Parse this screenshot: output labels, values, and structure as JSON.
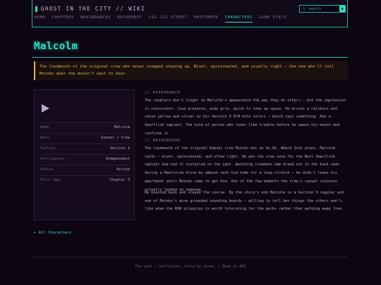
{
  "site": {
    "logo_text": "GHOST IN THE CITY // WIKI"
  },
  "search": {
    "placeholder": "// search"
  },
  "nav": {
    "items": [
      {
        "label": "HOME"
      },
      {
        "label": "CHAPTERS"
      },
      {
        "label": "BRAINDANCES"
      },
      {
        "label": "ROCKERBOY"
      },
      {
        "label": "JIG JIG STREET"
      },
      {
        "label": "PHOTOMODE"
      },
      {
        "label": "CHARACTERS"
      },
      {
        "label": "GONK STATS"
      }
    ],
    "active": "CHARACTERS"
  },
  "page": {
    "title": "Malcolm",
    "quote": "The loudmouth of the original crew who never stopped showing up. Blunt, opinionated, and usually right — the one who'll tell Motoko what she doesn't want to hear."
  },
  "infobox": {
    "icon": "play-icon",
    "rows": [
      {
        "key": "Name",
        "value": "Malcolm"
      },
      {
        "key": "Role",
        "value": "Gunner / Crew"
      },
      {
        "key": "Faction",
        "value": "Section 9"
      },
      {
        "key": "Affiliation",
        "value": "Independent"
      },
      {
        "key": "Status",
        "value": "Active"
      },
      {
        "key": "First App.",
        "value": "Chapter 3"
      }
    ]
  },
  "sections": {
    "appearance": {
      "heading": "// APPEARANCE",
      "text": "The chapters don't linger on Malcolm's appearance the way they do others', but the impression is consistent: loud presence, wide grin, quick to take up space. He drives a Caliburn and chose yellow and silver as his Section 9 ECM hole colors — which says something. Has a Smartlink implant. The kind of person who looks like trouble before he opens his mouth and confirms it."
    },
    "background": {
      "heading": "// BACKGROUND",
      "text1": "The loudmouth of the original Kabuki crew Motoko met at Hi-Oh. Where Ichi plans, Malcolm talks — blunt, opinionated, and often right. He won the crew vote for the Best Smartlink implant and had it installed on the spot. Watching crewmate Sam bleed out in the back seat during a Maelstrom drive-by ambush sent him home for a long stretch — he didn't leave his apartment until Motoko came to get him. One of the few moments the crew's casual violence actually landed on someone.",
      "text2": "He bounced back and stayed the course. By the story's end Malcolm is a Section 9 regular and one of Motoko's more grounded sounding boards — willing to tell her things the others won't, like when the NSN situation is worth tolerating for the perks rather than walking away free."
    }
  },
  "links": {
    "back": "← All Characters"
  },
  "footer": {
    "text": "Fan wiki — unofficial. Story by Sarax.  |  Read on AO3"
  },
  "colors": {
    "accent": "#2de2c9",
    "quote": "#e8b53a",
    "background": "#0d0612"
  }
}
